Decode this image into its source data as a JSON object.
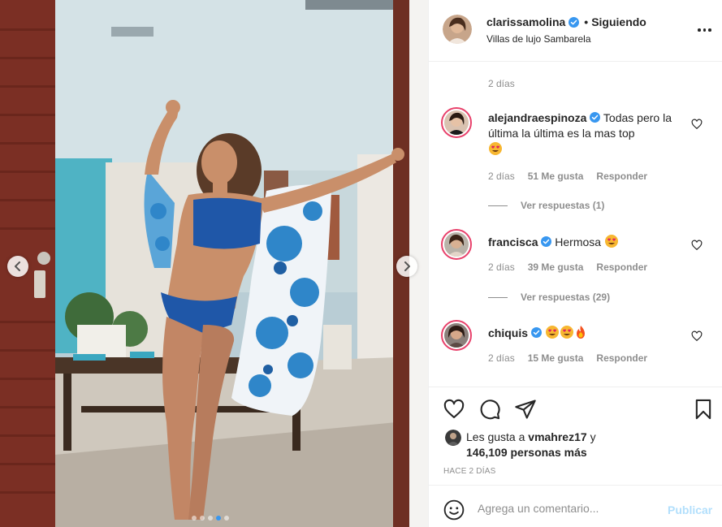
{
  "post": {
    "username": "clarissamolina",
    "separator": "•",
    "follow_label": "Siguiendo",
    "location": "Villas de lujo Sambarela",
    "carousel_dots": 5,
    "active_dot": 3
  },
  "comments": {
    "top_partial_time": "2 días",
    "items": [
      {
        "username": "alejandraespinoza",
        "verified": true,
        "text": "Todas pero la última la última es la mas top",
        "emojis": "heart-eyes",
        "time": "2 días",
        "likes": "51 Me gusta",
        "reply_label": "Responder",
        "view_replies": "Ver respuestas (1)"
      },
      {
        "username": "francisca",
        "verified": true,
        "text": "Hermosa",
        "emojis": "heart-eyes",
        "time": "2 días",
        "likes": "39 Me gusta",
        "reply_label": "Responder",
        "view_replies": "Ver respuestas (29)"
      },
      {
        "username": "chiquis",
        "verified": true,
        "text": "",
        "emojis": "heart-eyes heart-eyes fire",
        "time": "2 días",
        "likes": "15 Me gusta",
        "reply_label": "Responder"
      }
    ]
  },
  "likes": {
    "prefix": "Les gusta a",
    "user": "vmahrez17",
    "conj": "y",
    "others": "146,109 personas más"
  },
  "date_label": "HACE 2 DÍAS",
  "composer": {
    "placeholder": "Agrega un comentario...",
    "publish_label": "Publicar"
  },
  "colors": {
    "verified": "#3897f0",
    "publish_disabled": "#b2dffc",
    "muted": "#8e8e8e",
    "story_ring": "#e8416b"
  },
  "icons": {
    "like": "heart-outline-icon",
    "comment": "comment-bubble-icon",
    "share": "paper-plane-icon",
    "save": "bookmark-icon",
    "more": "more-horizontal-icon",
    "emoji": "smiley-icon",
    "prev": "chevron-left-icon",
    "next": "chevron-right-icon"
  }
}
